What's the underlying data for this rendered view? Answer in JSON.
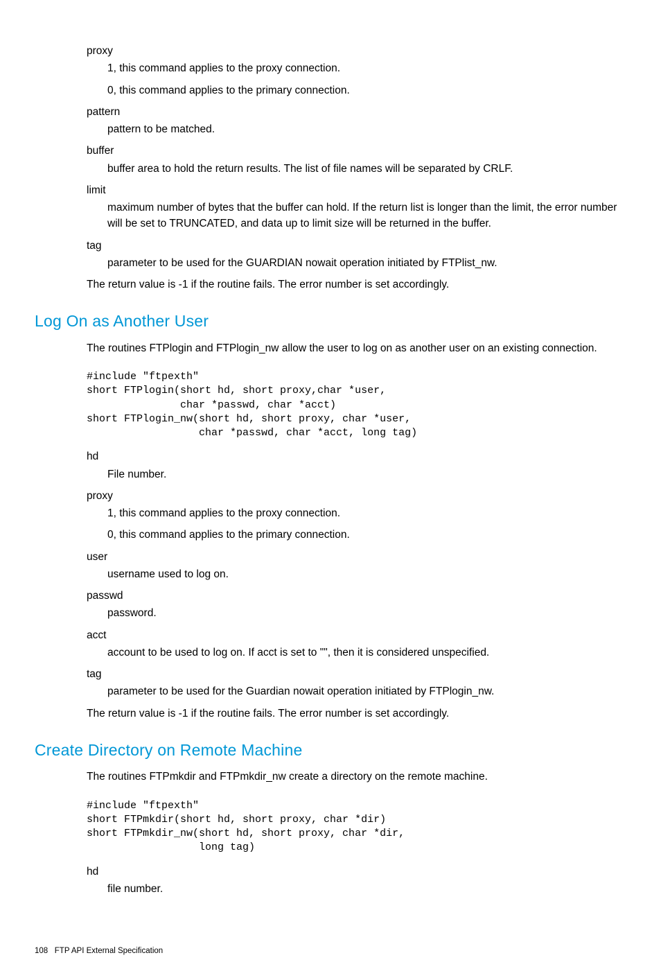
{
  "sec0": {
    "term_proxy": "proxy",
    "def_proxy_1": "1, this command applies to the proxy connection.",
    "def_proxy_0": "0, this command applies to the primary connection.",
    "term_pattern": "pattern",
    "def_pattern": "pattern to be matched.",
    "term_buffer": "buffer",
    "def_buffer": "buffer area to hold the return results. The list of file names will be separated by CRLF.",
    "term_limit": "limit",
    "def_limit": "maximum number of bytes that the buffer can hold. If the return list is longer than the limit, the error number will be set to TRUNCATED, and data up to limit size will be returned in the buffer.",
    "term_tag": "tag",
    "def_tag": "parameter to be used for the GUARDIAN nowait operation initiated by FTPlist_nw.",
    "retval": "The return value is -1 if the routine fails. The error number is set accordingly."
  },
  "sec1": {
    "heading": "Log On as Another User",
    "intro": "The routines FTPlogin and FTPlogin_nw allow the user to log on as another user on an existing connection.",
    "code": "#include \"ftpexth\"\nshort FTPlogin(short hd, short proxy,char *user,\n               char *passwd, char *acct)\nshort FTPlogin_nw(short hd, short proxy, char *user,\n                  char *passwd, char *acct, long tag)",
    "term_hd": "hd",
    "def_hd": "File number.",
    "term_proxy": "proxy",
    "def_proxy_1": "1, this command applies to the proxy connection.",
    "def_proxy_0": "0, this command applies to the primary connection.",
    "term_user": "user",
    "def_user": "username used to log on.",
    "term_passwd": "passwd",
    "def_passwd": "password.",
    "term_acct": "acct",
    "def_acct": "account to be used to log on. If acct is set to \"\", then it is considered unspecified.",
    "term_tag": "tag",
    "def_tag": "parameter to be used for the Guardian nowait operation initiated by FTPlogin_nw.",
    "retval": "The return value is -1 if the routine fails. The error number is set accordingly."
  },
  "sec2": {
    "heading": "Create Directory on Remote Machine",
    "intro": "The routines FTPmkdir and FTPmkdir_nw create a directory on the remote machine.",
    "code": "#include \"ftpexth\"\nshort FTPmkdir(short hd, short proxy, char *dir)\nshort FTPmkdir_nw(short hd, short proxy, char *dir,\n                  long tag)",
    "term_hd": "hd",
    "def_hd": "file number."
  },
  "footer": {
    "pagenum": "108",
    "chapter": "FTP API External Specification"
  }
}
